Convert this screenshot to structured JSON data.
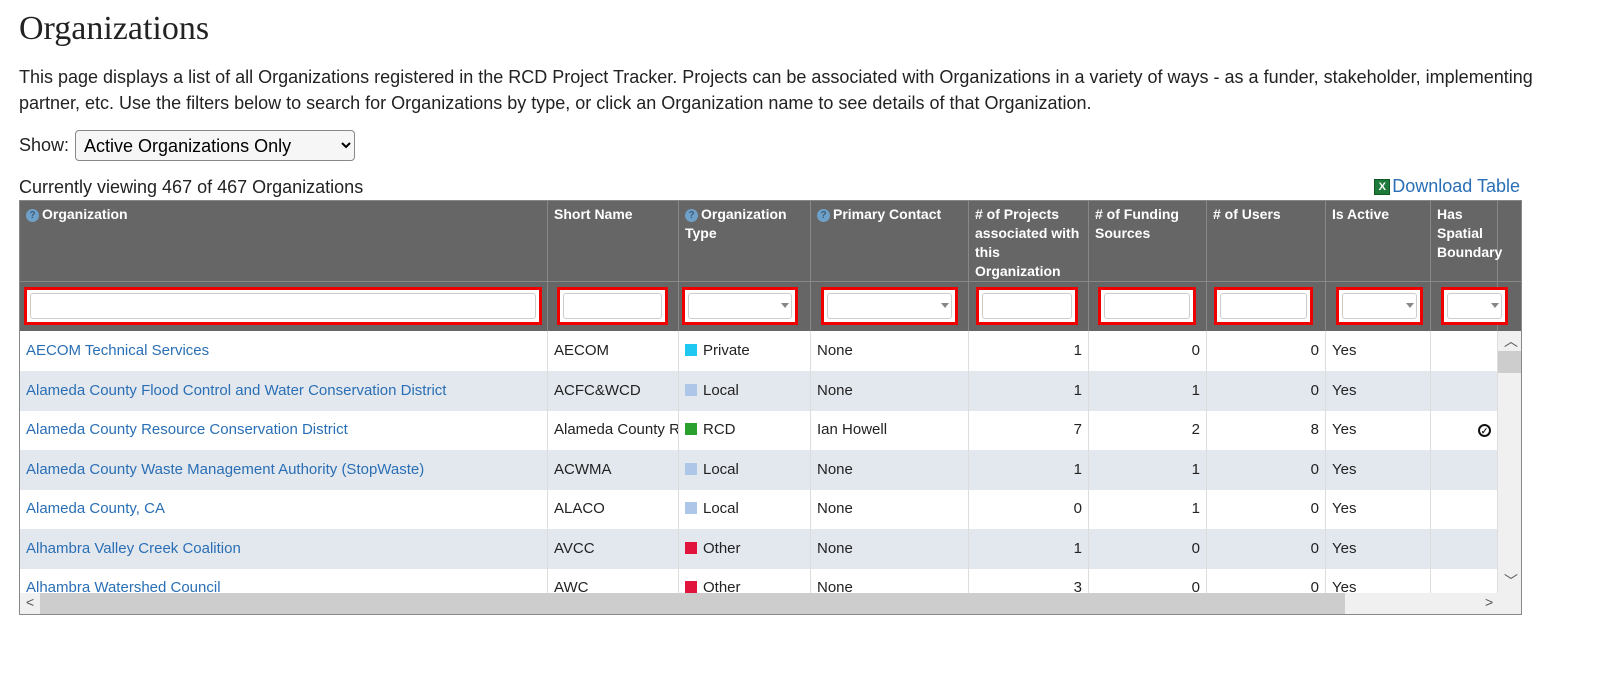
{
  "page": {
    "title": "Organizations",
    "description": "This page displays a list of all Organizations registered in the RCD Project Tracker. Projects can be associated with Organizations in a variety of ways - as a funder, stakeholder, implementing partner, etc. Use the filters below to search for Organizations by type, or click an Organization name to see details of that Organization."
  },
  "filter": {
    "label": "Show:",
    "selected": "Active Organizations Only"
  },
  "count_text": "Currently viewing 467 of 467 Organizations",
  "download": {
    "label": "Download Table",
    "icon": "excel-icon"
  },
  "columns": [
    "Organization",
    "Short Name",
    "Organization Type",
    "Primary Contact",
    "# of Projects associated with this Organization",
    "# of Funding Sources",
    "# of Users",
    "Is Active",
    "Has Spatial Boundary"
  ],
  "type_colors": {
    "Private": "#1ec8f0",
    "Local": "#aec7e8",
    "RCD": "#2ca02c",
    "Other": "#e0143c"
  },
  "rows": [
    {
      "org": "AECOM Technical Services",
      "short": "AECOM",
      "type": "Private",
      "contact": "None",
      "projects": "1",
      "funding": "0",
      "users": "0",
      "active": "Yes",
      "spatial": false
    },
    {
      "org": "Alameda County Flood Control and Water Conservation District",
      "short": "ACFC&WCD",
      "type": "Local",
      "contact": "None",
      "projects": "1",
      "funding": "1",
      "users": "0",
      "active": "Yes",
      "spatial": false
    },
    {
      "org": "Alameda County Resource Conservation District",
      "short": "Alameda County RCD",
      "type": "RCD",
      "contact": "Ian Howell",
      "projects": "7",
      "funding": "2",
      "users": "8",
      "active": "Yes",
      "spatial": true
    },
    {
      "org": "Alameda County Waste Management Authority (StopWaste)",
      "short": "ACWMA",
      "type": "Local",
      "contact": "None",
      "projects": "1",
      "funding": "1",
      "users": "0",
      "active": "Yes",
      "spatial": false
    },
    {
      "org": "Alameda County, CA",
      "short": "ALACO",
      "type": "Local",
      "contact": "None",
      "projects": "0",
      "funding": "1",
      "users": "0",
      "active": "Yes",
      "spatial": false
    },
    {
      "org": "Alhambra Valley Creek Coalition",
      "short": "AVCC",
      "type": "Other",
      "contact": "None",
      "projects": "1",
      "funding": "0",
      "users": "0",
      "active": "Yes",
      "spatial": false
    },
    {
      "org": "Alhambra Watershed Council",
      "short": "AWC",
      "type": "Other",
      "contact": "None",
      "projects": "3",
      "funding": "0",
      "users": "0",
      "active": "Yes",
      "spatial": false
    }
  ]
}
